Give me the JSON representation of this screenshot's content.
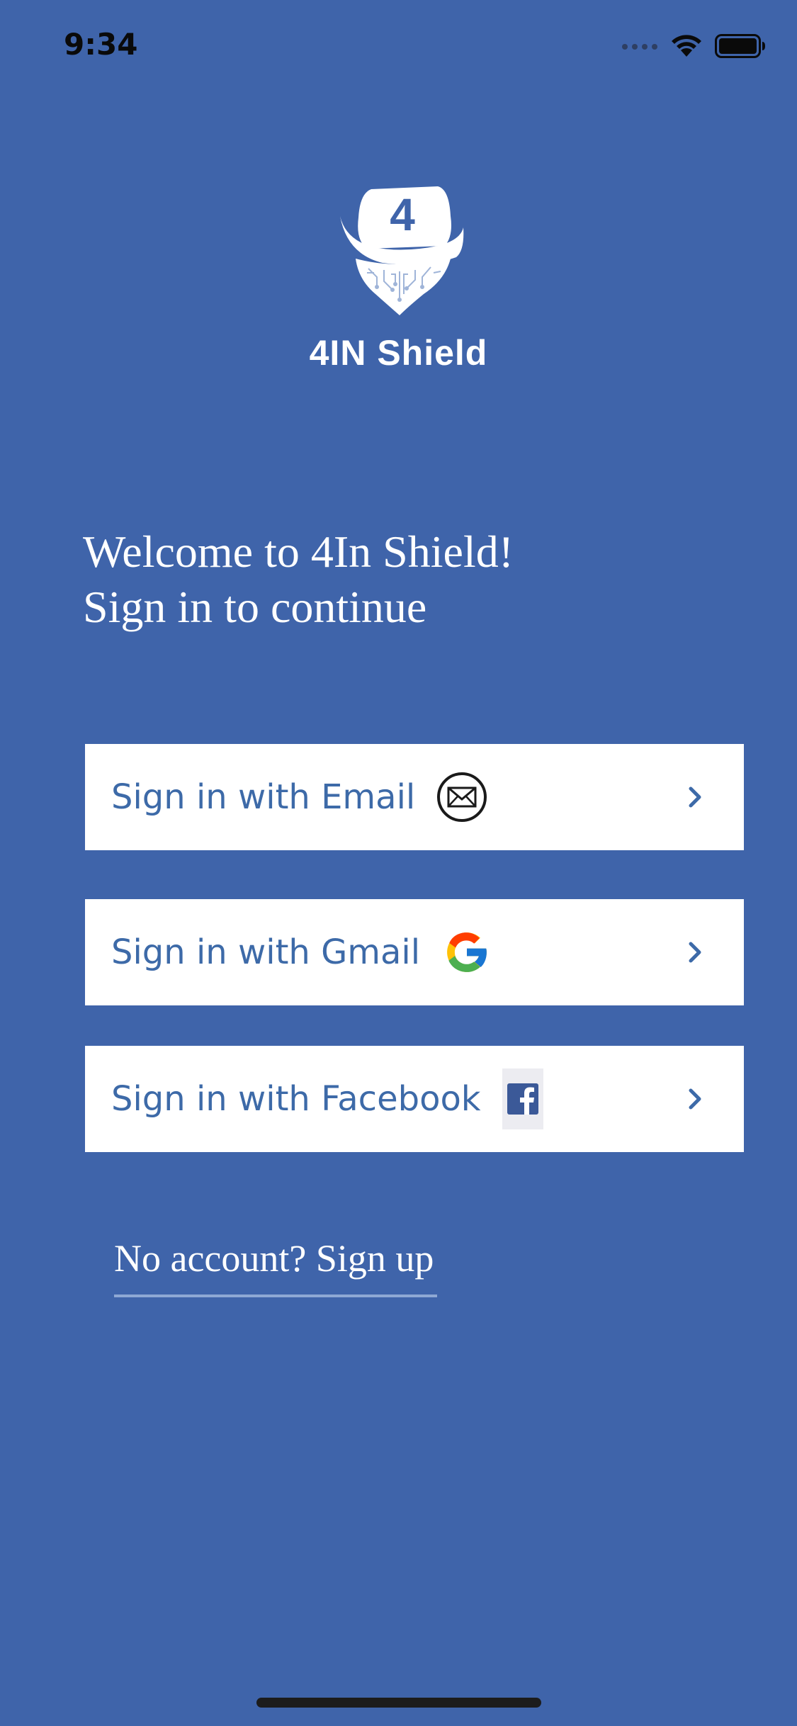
{
  "status_bar": {
    "time": "9:34",
    "icons": [
      "signal-dots-icon",
      "wifi-icon",
      "battery-icon"
    ]
  },
  "logo": {
    "badge_text": "4",
    "name": "4IN Shield"
  },
  "welcome": {
    "line1": "Welcome to 4In Shield!",
    "line2": "Sign in to continue"
  },
  "buttons": [
    {
      "label": "Sign in with Email",
      "icon": "envelope-icon"
    },
    {
      "label": "Sign in with Gmail",
      "icon": "google-icon"
    },
    {
      "label": "Sign in with Facebook",
      "icon": "facebook-icon"
    }
  ],
  "signup": {
    "label": "No account? Sign up"
  },
  "colors": {
    "background": "#3f64aa",
    "button_background": "#ffffff",
    "button_text": "#3d6aa8",
    "facebook_blue": "#3b5998"
  }
}
